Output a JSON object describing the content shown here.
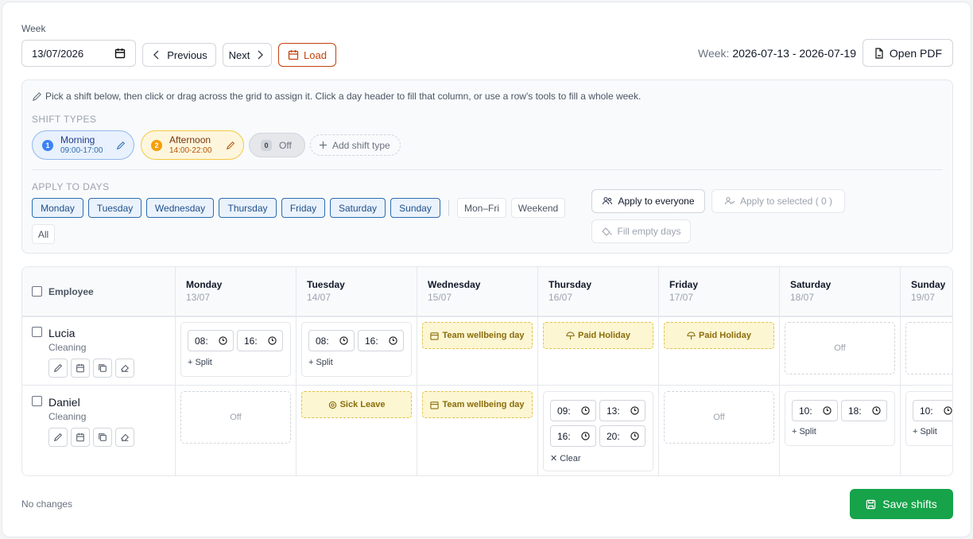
{
  "header": {
    "week_label": "Week",
    "week_value": "13/07/2026",
    "prev_label": "Previous",
    "next_label": "Next",
    "load_label": "Load",
    "week_range_prefix": "Week:",
    "week_range": "2026-07-13 - 2026-07-19",
    "open_pdf_label": "Open PDF"
  },
  "panel": {
    "hint": "Pick a shift below, then click or drag across the grid to assign it. Click a day header to fill that column, or use a row's tools to fill a whole week.",
    "shift_types_title": "SHIFT TYPES",
    "shift_types": [
      {
        "num": "1",
        "name": "Morning",
        "time": "09:00-17:00",
        "color": "#3b82f6"
      },
      {
        "num": "2",
        "name": "Afternoon",
        "time": "14:00-22:00",
        "color": "#f59e0b"
      },
      {
        "num": "0",
        "name": "Off"
      }
    ],
    "add_shift_type": "Add shift type",
    "apply_days_title": "APPLY TO DAYS",
    "days": [
      "Monday",
      "Tuesday",
      "Wednesday",
      "Thursday",
      "Friday",
      "Saturday",
      "Sunday"
    ],
    "presets": [
      "Mon–Fri",
      "Weekend",
      "All"
    ],
    "apply_everyone": "Apply to everyone",
    "apply_selected": "Apply to selected ( 0 )",
    "fill_empty": "Fill empty days"
  },
  "table": {
    "employee_header": "Employee",
    "columns": [
      {
        "day": "Monday",
        "date": "13/07"
      },
      {
        "day": "Tuesday",
        "date": "14/07"
      },
      {
        "day": "Wednesday",
        "date": "15/07"
      },
      {
        "day": "Thursday",
        "date": "16/07"
      },
      {
        "day": "Friday",
        "date": "17/07"
      },
      {
        "day": "Saturday",
        "date": "18/07"
      },
      {
        "day": "Sunday",
        "date": "19/07"
      }
    ],
    "rows": [
      {
        "name": "Lucia",
        "role": "Cleaning",
        "mon": {
          "start": "08:",
          "end": "16:",
          "split": "Split"
        },
        "tue": {
          "start": "08:",
          "end": "16:",
          "split": "Split"
        },
        "wed": "Team wellbeing day",
        "thu": "Paid Holiday",
        "fri": "Paid Holiday",
        "sat": "Off"
      },
      {
        "name": "Daniel",
        "role": "Cleaning",
        "mon": "Off",
        "tue": "Sick Leave",
        "wed": "Team wellbeing day",
        "thu": {
          "start1": "09:",
          "end1": "13:",
          "start2": "16:",
          "end2": "20:",
          "clear": "Clear"
        },
        "fri": "Off",
        "sat": {
          "start": "10:",
          "end": "18:",
          "split": "Split"
        },
        "sun": {
          "start": "10:",
          "split": "Split"
        }
      }
    ]
  },
  "footer": {
    "status": "No changes",
    "save_label": "Save shifts"
  },
  "colors": {
    "accent_blue": "#2b6cb0",
    "load_orange": "#c2410c",
    "save_green": "#16a34a",
    "event_yellow": "#fdf6d3"
  }
}
